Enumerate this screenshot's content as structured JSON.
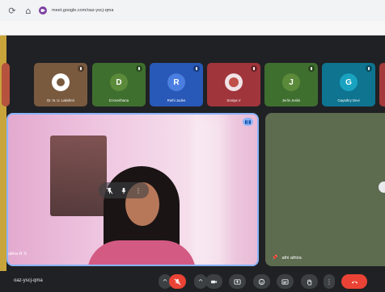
{
  "browser": {
    "url": "meet.google.com/oaz-yscj-qma"
  },
  "colors": {
    "accent": "#8ab4f8",
    "danger": "#ea4335",
    "background": "#202124"
  },
  "participants_strip": [
    {
      "name": "",
      "initial": "",
      "tile_color": "#b5533f"
    },
    {
      "name": "Dr. N. U. Lakshmi",
      "initial": "",
      "tile_color": "#7a5a3f"
    },
    {
      "name": "D.Keerthana",
      "initial": "D",
      "tile_color": "#3f6f2f"
    },
    {
      "name": "Rethi Judes",
      "initial": "R",
      "tile_color": "#2859b8"
    },
    {
      "name": "Soniya V",
      "initial": "",
      "tile_color": "#a0353b"
    },
    {
      "name": "Jerlin Jeslin",
      "initial": "J",
      "tile_color": "#3f6f2f"
    },
    {
      "name": "Gayathry Devi",
      "initial": "G",
      "tile_color": "#0e7490"
    },
    {
      "name": "",
      "initial": "",
      "tile_color": "#a43a3a"
    }
  ],
  "main_tile": {
    "name": "ubha R S"
  },
  "side_tile": {
    "name": "athi athira"
  },
  "meeting": {
    "code": "oaz-yscj-qma"
  }
}
